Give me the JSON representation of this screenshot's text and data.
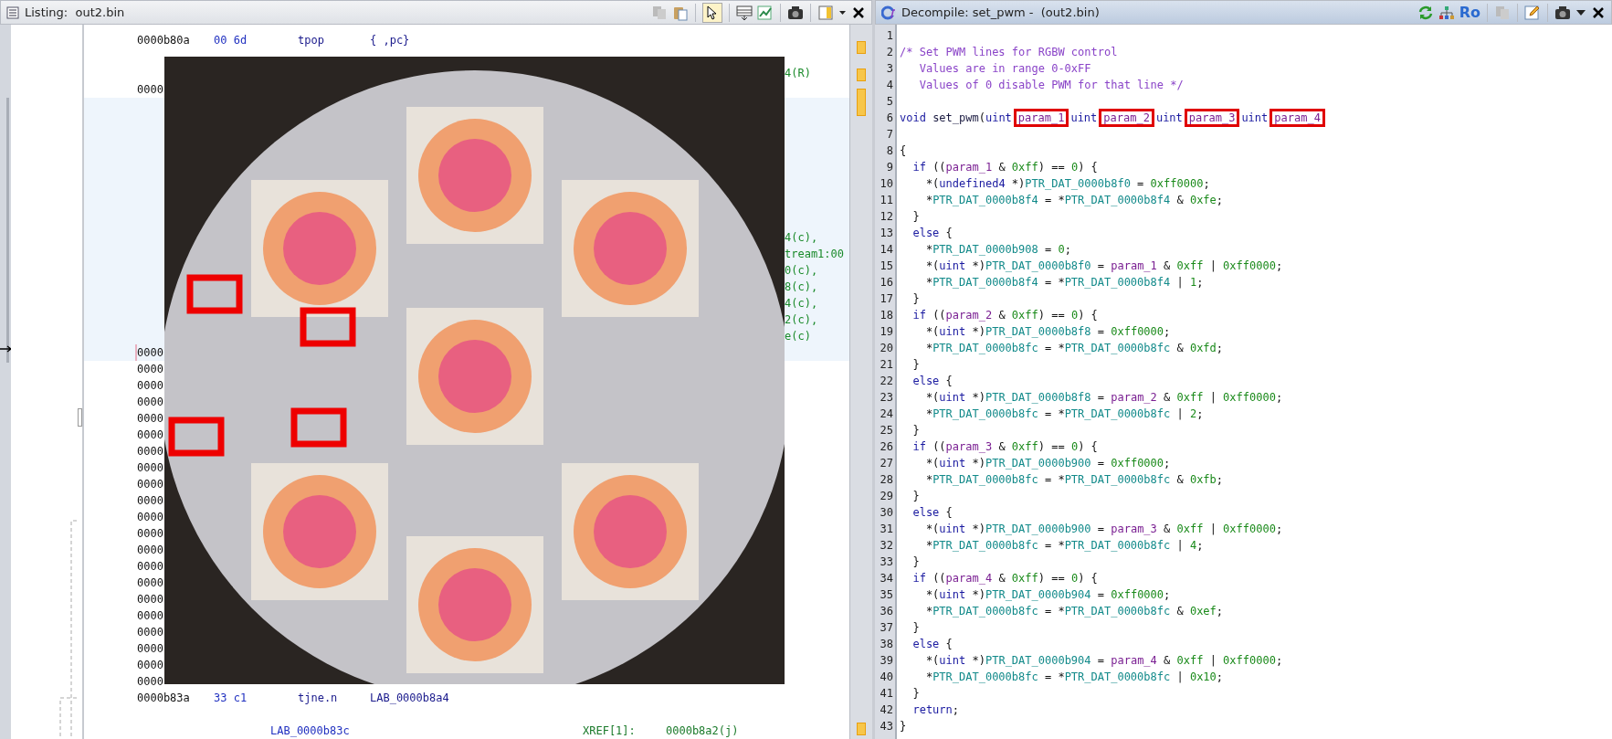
{
  "listing": {
    "title": "Listing:  out2.bin",
    "pointer_tool_selected": true,
    "rows": [
      {
        "kind": "instruction",
        "address": "0000b80a",
        "bytes": "00 6d",
        "mnemonic": "tpop",
        "operands": "{ ,pc}"
      },
      {
        "kind": "fragment",
        "text": "4(R)"
      },
      {
        "kind": "address",
        "text": "0000"
      },
      {
        "kind": "fragment",
        "text": "4(c),"
      },
      {
        "kind": "fragment",
        "text": "tream1:00"
      },
      {
        "kind": "fragment",
        "text": "0(c),"
      },
      {
        "kind": "fragment",
        "text": "8(c),"
      },
      {
        "kind": "fragment",
        "text": "4(c),"
      },
      {
        "kind": "fragment",
        "text": "2(c),"
      },
      {
        "kind": "fragment",
        "text": "e(c)"
      },
      {
        "kind": "address",
        "text": "0000"
      },
      {
        "kind": "address",
        "text": "0000"
      },
      {
        "kind": "address",
        "text": "0000"
      },
      {
        "kind": "address",
        "text": "0000"
      },
      {
        "kind": "address",
        "text": "0000"
      },
      {
        "kind": "address",
        "text": "0000"
      },
      {
        "kind": "address",
        "text": "0000"
      },
      {
        "kind": "address",
        "text": "0000"
      },
      {
        "kind": "address",
        "text": "0000"
      },
      {
        "kind": "address",
        "text": "0000"
      },
      {
        "kind": "address",
        "text": "0000"
      },
      {
        "kind": "address",
        "text": "0000"
      },
      {
        "kind": "address",
        "text": "0000"
      },
      {
        "kind": "address",
        "text": "0000"
      },
      {
        "kind": "address",
        "text": "0000"
      },
      {
        "kind": "address",
        "text": "0000"
      },
      {
        "kind": "address",
        "text": "0000"
      },
      {
        "kind": "address",
        "text": "0000"
      },
      {
        "kind": "address",
        "text": "0000"
      },
      {
        "kind": "address",
        "text": "0000"
      },
      {
        "kind": "address",
        "text": "0000"
      },
      {
        "kind": "instruction",
        "address": "0000b83a",
        "bytes": "33 c1",
        "mnemonic": "tjne.n",
        "operands": "LAB_0000b8a4"
      },
      {
        "kind": "label",
        "label": "LAB_0000b83c",
        "xref_label": "XREF[1]:",
        "xref_address": "0000b8a2(j)"
      }
    ]
  },
  "decompile": {
    "title": "Decompile: set_pwm -  (out2.bin)",
    "read_only_label": "Ro",
    "lines": [
      {
        "number": "1"
      },
      {
        "number": "2",
        "tokens": [
          {
            "kind": "comment",
            "text": "/* Set PWM lines for RGBW control"
          }
        ]
      },
      {
        "number": "3",
        "tokens": [
          {
            "kind": "comment",
            "text": "   Values are in range 0-0xFF"
          }
        ]
      },
      {
        "number": "4",
        "tokens": [
          {
            "kind": "comment",
            "text": "   Values of 0 disable PWM for that line */"
          }
        ]
      },
      {
        "number": "5"
      },
      {
        "number": "6",
        "tokens": [
          {
            "kind": "type",
            "text": "void"
          },
          {
            "kind": "function",
            "text": " set_pwm"
          },
          {
            "kind": "plain",
            "text": "("
          },
          {
            "kind": "type",
            "text": "uint"
          },
          {
            "kind": "param_boxed",
            "text": "param_1"
          },
          {
            "kind": "type",
            "text": "uint"
          },
          {
            "kind": "param_boxed",
            "text": "param_2"
          },
          {
            "kind": "type",
            "text": "uint"
          },
          {
            "kind": "param_boxed",
            "text": "param_3"
          },
          {
            "kind": "type",
            "text": "uint"
          },
          {
            "kind": "param_boxed",
            "text": "param_4"
          }
        ]
      },
      {
        "number": "7"
      },
      {
        "number": "8",
        "tokens": [
          {
            "kind": "plain",
            "text": "{"
          }
        ]
      },
      {
        "number": "9",
        "tokens": [
          {
            "kind": "keyword",
            "text": "  if"
          },
          {
            "kind": "plain",
            "text": " (("
          },
          {
            "kind": "param",
            "text": "param_1"
          },
          {
            "kind": "plain",
            "text": " & "
          },
          {
            "kind": "number",
            "text": "0xff"
          },
          {
            "kind": "plain",
            "text": ") == "
          },
          {
            "kind": "number",
            "text": "0"
          },
          {
            "kind": "plain",
            "text": ") {"
          }
        ]
      },
      {
        "number": "10",
        "tokens": [
          {
            "kind": "plain",
            "text": "    *("
          },
          {
            "kind": "type",
            "text": "undefined4"
          },
          {
            "kind": "plain",
            "text": " *)"
          },
          {
            "kind": "global",
            "text": "PTR_DAT_0000b8f0"
          },
          {
            "kind": "plain",
            "text": " = "
          },
          {
            "kind": "number",
            "text": "0xff0000"
          },
          {
            "kind": "plain",
            "text": ";"
          }
        ]
      },
      {
        "number": "11",
        "tokens": [
          {
            "kind": "plain",
            "text": "    *"
          },
          {
            "kind": "global",
            "text": "PTR_DAT_0000b8f4"
          },
          {
            "kind": "plain",
            "text": " = *"
          },
          {
            "kind": "global",
            "text": "PTR_DAT_0000b8f4"
          },
          {
            "kind": "plain",
            "text": " & "
          },
          {
            "kind": "number",
            "text": "0xfe"
          },
          {
            "kind": "plain",
            "text": ";"
          }
        ]
      },
      {
        "number": "12",
        "tokens": [
          {
            "kind": "plain",
            "text": "  }"
          }
        ]
      },
      {
        "number": "13",
        "tokens": [
          {
            "kind": "keyword",
            "text": "  else"
          },
          {
            "kind": "plain",
            "text": " {"
          }
        ]
      },
      {
        "number": "14",
        "tokens": [
          {
            "kind": "plain",
            "text": "    *"
          },
          {
            "kind": "global",
            "text": "PTR_DAT_0000b908"
          },
          {
            "kind": "plain",
            "text": " = "
          },
          {
            "kind": "number",
            "text": "0"
          },
          {
            "kind": "plain",
            "text": ";"
          }
        ]
      },
      {
        "number": "15",
        "tokens": [
          {
            "kind": "plain",
            "text": "    *("
          },
          {
            "kind": "type",
            "text": "uint"
          },
          {
            "kind": "plain",
            "text": " *)"
          },
          {
            "kind": "global",
            "text": "PTR_DAT_0000b8f0"
          },
          {
            "kind": "plain",
            "text": " = "
          },
          {
            "kind": "param",
            "text": "param_1"
          },
          {
            "kind": "plain",
            "text": " & "
          },
          {
            "kind": "number",
            "text": "0xff"
          },
          {
            "kind": "plain",
            "text": " | "
          },
          {
            "kind": "number",
            "text": "0xff0000"
          },
          {
            "kind": "plain",
            "text": ";"
          }
        ]
      },
      {
        "number": "16",
        "tokens": [
          {
            "kind": "plain",
            "text": "    *"
          },
          {
            "kind": "global",
            "text": "PTR_DAT_0000b8f4"
          },
          {
            "kind": "plain",
            "text": " = *"
          },
          {
            "kind": "global",
            "text": "PTR_DAT_0000b8f4"
          },
          {
            "kind": "plain",
            "text": " | "
          },
          {
            "kind": "number",
            "text": "1"
          },
          {
            "kind": "plain",
            "text": ";"
          }
        ]
      },
      {
        "number": "17",
        "tokens": [
          {
            "kind": "plain",
            "text": "  }"
          }
        ]
      },
      {
        "number": "18",
        "tokens": [
          {
            "kind": "keyword",
            "text": "  if"
          },
          {
            "kind": "plain",
            "text": " (("
          },
          {
            "kind": "param",
            "text": "param_2"
          },
          {
            "kind": "plain",
            "text": " & "
          },
          {
            "kind": "number",
            "text": "0xff"
          },
          {
            "kind": "plain",
            "text": ") == "
          },
          {
            "kind": "number",
            "text": "0"
          },
          {
            "kind": "plain",
            "text": ") {"
          }
        ]
      },
      {
        "number": "19",
        "tokens": [
          {
            "kind": "plain",
            "text": "    *("
          },
          {
            "kind": "type",
            "text": "uint"
          },
          {
            "kind": "plain",
            "text": " *)"
          },
          {
            "kind": "global",
            "text": "PTR_DAT_0000b8f8"
          },
          {
            "kind": "plain",
            "text": " = "
          },
          {
            "kind": "number",
            "text": "0xff0000"
          },
          {
            "kind": "plain",
            "text": ";"
          }
        ]
      },
      {
        "number": "20",
        "tokens": [
          {
            "kind": "plain",
            "text": "    *"
          },
          {
            "kind": "global",
            "text": "PTR_DAT_0000b8fc"
          },
          {
            "kind": "plain",
            "text": " = *"
          },
          {
            "kind": "global",
            "text": "PTR_DAT_0000b8fc"
          },
          {
            "kind": "plain",
            "text": " & "
          },
          {
            "kind": "number",
            "text": "0xfd"
          },
          {
            "kind": "plain",
            "text": ";"
          }
        ]
      },
      {
        "number": "21",
        "tokens": [
          {
            "kind": "plain",
            "text": "  }"
          }
        ]
      },
      {
        "number": "22",
        "tokens": [
          {
            "kind": "keyword",
            "text": "  else"
          },
          {
            "kind": "plain",
            "text": " {"
          }
        ]
      },
      {
        "number": "23",
        "tokens": [
          {
            "kind": "plain",
            "text": "    *("
          },
          {
            "kind": "type",
            "text": "uint"
          },
          {
            "kind": "plain",
            "text": " *)"
          },
          {
            "kind": "global",
            "text": "PTR_DAT_0000b8f8"
          },
          {
            "kind": "plain",
            "text": " = "
          },
          {
            "kind": "param",
            "text": "param_2"
          },
          {
            "kind": "plain",
            "text": " & "
          },
          {
            "kind": "number",
            "text": "0xff"
          },
          {
            "kind": "plain",
            "text": " | "
          },
          {
            "kind": "number",
            "text": "0xff0000"
          },
          {
            "kind": "plain",
            "text": ";"
          }
        ]
      },
      {
        "number": "24",
        "tokens": [
          {
            "kind": "plain",
            "text": "    *"
          },
          {
            "kind": "global",
            "text": "PTR_DAT_0000b8fc"
          },
          {
            "kind": "plain",
            "text": " = *"
          },
          {
            "kind": "global",
            "text": "PTR_DAT_0000b8fc"
          },
          {
            "kind": "plain",
            "text": " | "
          },
          {
            "kind": "number",
            "text": "2"
          },
          {
            "kind": "plain",
            "text": ";"
          }
        ]
      },
      {
        "number": "25",
        "tokens": [
          {
            "kind": "plain",
            "text": "  }"
          }
        ]
      },
      {
        "number": "26",
        "tokens": [
          {
            "kind": "keyword",
            "text": "  if"
          },
          {
            "kind": "plain",
            "text": " (("
          },
          {
            "kind": "param",
            "text": "param_3"
          },
          {
            "kind": "plain",
            "text": " & "
          },
          {
            "kind": "number",
            "text": "0xff"
          },
          {
            "kind": "plain",
            "text": ") == "
          },
          {
            "kind": "number",
            "text": "0"
          },
          {
            "kind": "plain",
            "text": ") {"
          }
        ]
      },
      {
        "number": "27",
        "tokens": [
          {
            "kind": "plain",
            "text": "    *("
          },
          {
            "kind": "type",
            "text": "uint"
          },
          {
            "kind": "plain",
            "text": " *)"
          },
          {
            "kind": "global",
            "text": "PTR_DAT_0000b900"
          },
          {
            "kind": "plain",
            "text": " = "
          },
          {
            "kind": "number",
            "text": "0xff0000"
          },
          {
            "kind": "plain",
            "text": ";"
          }
        ]
      },
      {
        "number": "28",
        "tokens": [
          {
            "kind": "plain",
            "text": "    *"
          },
          {
            "kind": "global",
            "text": "PTR_DAT_0000b8fc"
          },
          {
            "kind": "plain",
            "text": " = *"
          },
          {
            "kind": "global",
            "text": "PTR_DAT_0000b8fc"
          },
          {
            "kind": "plain",
            "text": " & "
          },
          {
            "kind": "number",
            "text": "0xfb"
          },
          {
            "kind": "plain",
            "text": ";"
          }
        ]
      },
      {
        "number": "29",
        "tokens": [
          {
            "kind": "plain",
            "text": "  }"
          }
        ]
      },
      {
        "number": "30",
        "tokens": [
          {
            "kind": "keyword",
            "text": "  else"
          },
          {
            "kind": "plain",
            "text": " {"
          }
        ]
      },
      {
        "number": "31",
        "tokens": [
          {
            "kind": "plain",
            "text": "    *("
          },
          {
            "kind": "type",
            "text": "uint"
          },
          {
            "kind": "plain",
            "text": " *)"
          },
          {
            "kind": "global",
            "text": "PTR_DAT_0000b900"
          },
          {
            "kind": "plain",
            "text": " = "
          },
          {
            "kind": "param",
            "text": "param_3"
          },
          {
            "kind": "plain",
            "text": " & "
          },
          {
            "kind": "number",
            "text": "0xff"
          },
          {
            "kind": "plain",
            "text": " | "
          },
          {
            "kind": "number",
            "text": "0xff0000"
          },
          {
            "kind": "plain",
            "text": ";"
          }
        ]
      },
      {
        "number": "32",
        "tokens": [
          {
            "kind": "plain",
            "text": "    *"
          },
          {
            "kind": "global",
            "text": "PTR_DAT_0000b8fc"
          },
          {
            "kind": "plain",
            "text": " = *"
          },
          {
            "kind": "global",
            "text": "PTR_DAT_0000b8fc"
          },
          {
            "kind": "plain",
            "text": " | "
          },
          {
            "kind": "number",
            "text": "4"
          },
          {
            "kind": "plain",
            "text": ";"
          }
        ]
      },
      {
        "number": "33",
        "tokens": [
          {
            "kind": "plain",
            "text": "  }"
          }
        ]
      },
      {
        "number": "34",
        "tokens": [
          {
            "kind": "keyword",
            "text": "  if"
          },
          {
            "kind": "plain",
            "text": " (("
          },
          {
            "kind": "param",
            "text": "param_4"
          },
          {
            "kind": "plain",
            "text": " & "
          },
          {
            "kind": "number",
            "text": "0xff"
          },
          {
            "kind": "plain",
            "text": ") == "
          },
          {
            "kind": "number",
            "text": "0"
          },
          {
            "kind": "plain",
            "text": ") {"
          }
        ]
      },
      {
        "number": "35",
        "tokens": [
          {
            "kind": "plain",
            "text": "    *("
          },
          {
            "kind": "type",
            "text": "uint"
          },
          {
            "kind": "plain",
            "text": " *)"
          },
          {
            "kind": "global",
            "text": "PTR_DAT_0000b904"
          },
          {
            "kind": "plain",
            "text": " = "
          },
          {
            "kind": "number",
            "text": "0xff0000"
          },
          {
            "kind": "plain",
            "text": ";"
          }
        ]
      },
      {
        "number": "36",
        "tokens": [
          {
            "kind": "plain",
            "text": "    *"
          },
          {
            "kind": "global",
            "text": "PTR_DAT_0000b8fc"
          },
          {
            "kind": "plain",
            "text": " = *"
          },
          {
            "kind": "global",
            "text": "PTR_DAT_0000b8fc"
          },
          {
            "kind": "plain",
            "text": " & "
          },
          {
            "kind": "number",
            "text": "0xef"
          },
          {
            "kind": "plain",
            "text": ";"
          }
        ]
      },
      {
        "number": "37",
        "tokens": [
          {
            "kind": "plain",
            "text": "  }"
          }
        ]
      },
      {
        "number": "38",
        "tokens": [
          {
            "kind": "keyword",
            "text": "  else"
          },
          {
            "kind": "plain",
            "text": " {"
          }
        ]
      },
      {
        "number": "39",
        "tokens": [
          {
            "kind": "plain",
            "text": "    *("
          },
          {
            "kind": "type",
            "text": "uint"
          },
          {
            "kind": "plain",
            "text": " *)"
          },
          {
            "kind": "global",
            "text": "PTR_DAT_0000b904"
          },
          {
            "kind": "plain",
            "text": " = "
          },
          {
            "kind": "param",
            "text": "param_4"
          },
          {
            "kind": "plain",
            "text": " & "
          },
          {
            "kind": "number",
            "text": "0xff"
          },
          {
            "kind": "plain",
            "text": " | "
          },
          {
            "kind": "number",
            "text": "0xff0000"
          },
          {
            "kind": "plain",
            "text": ";"
          }
        ]
      },
      {
        "number": "40",
        "tokens": [
          {
            "kind": "plain",
            "text": "    *"
          },
          {
            "kind": "global",
            "text": "PTR_DAT_0000b8fc"
          },
          {
            "kind": "plain",
            "text": " = *"
          },
          {
            "kind": "global",
            "text": "PTR_DAT_0000b8fc"
          },
          {
            "kind": "plain",
            "text": " | "
          },
          {
            "kind": "number",
            "text": "0x10"
          },
          {
            "kind": "plain",
            "text": ";"
          }
        ]
      },
      {
        "number": "41",
        "tokens": [
          {
            "kind": "plain",
            "text": "  }"
          }
        ]
      },
      {
        "number": "42",
        "tokens": [
          {
            "kind": "keyword",
            "text": "  return"
          },
          {
            "kind": "plain",
            "text": ";"
          }
        ]
      },
      {
        "number": "43",
        "tokens": [
          {
            "kind": "plain",
            "text": "}"
          }
        ]
      }
    ]
  }
}
